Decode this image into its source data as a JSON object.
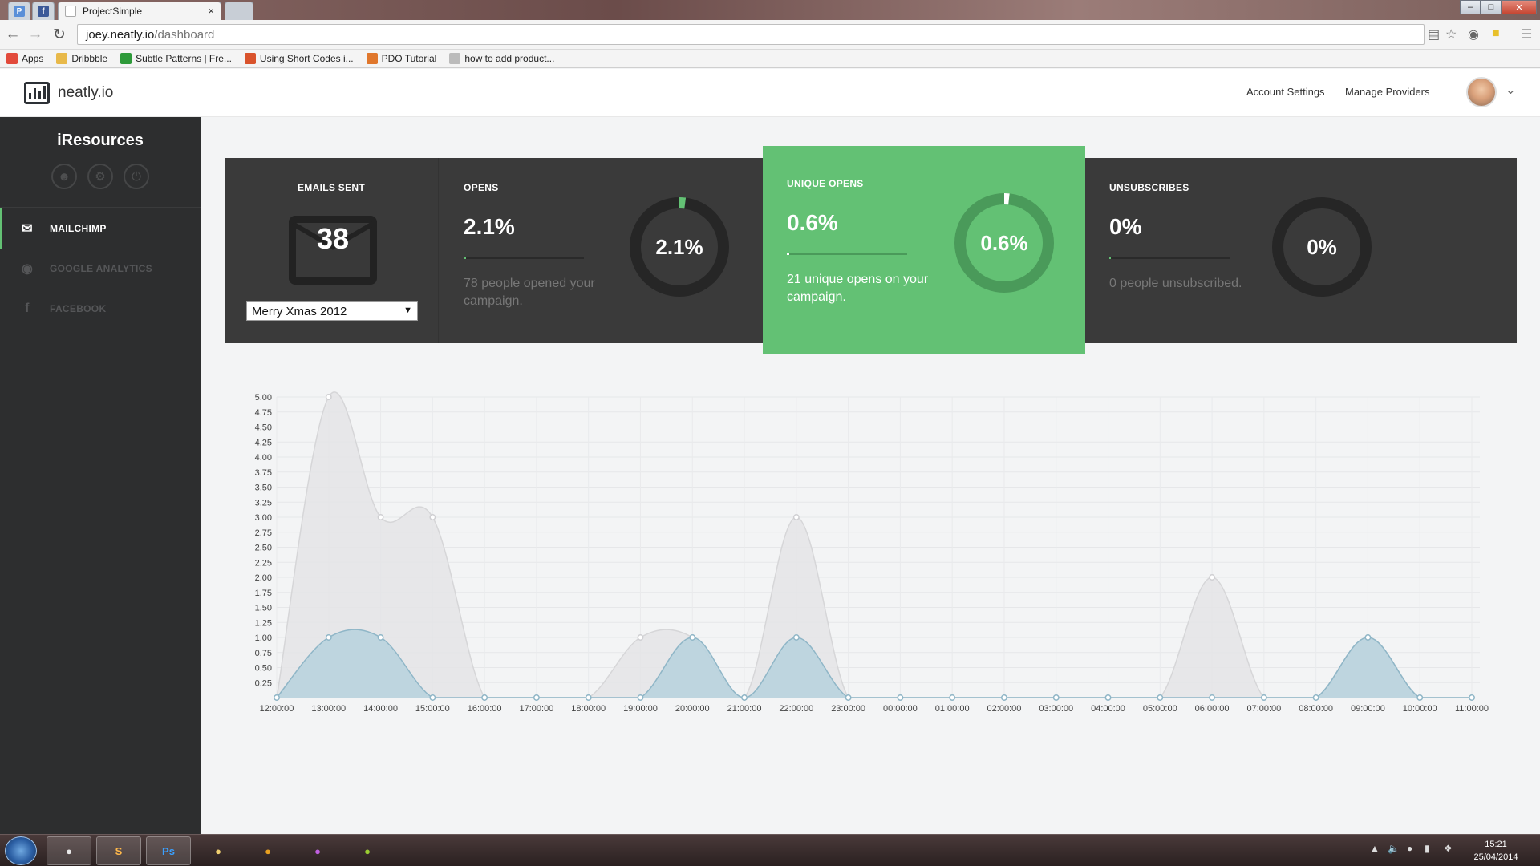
{
  "browser": {
    "tabs": [
      {
        "label": "ProjectSimple",
        "close": "×"
      }
    ],
    "url_host": "joey.neatly.io",
    "url_path": "/dashboard",
    "bookmarks": [
      {
        "label": "Apps",
        "icon": "apps-grid-icon",
        "color": "#e24a3b"
      },
      {
        "label": "Dribbble",
        "icon": "folder-icon",
        "color": "#e8b94a"
      },
      {
        "label": "Subtle Patterns | Fre...",
        "icon": "subtle-patterns-icon",
        "color": "#2e9a3a"
      },
      {
        "label": "Using Short Codes i...",
        "icon": "m-icon",
        "color": "#d9532c"
      },
      {
        "label": "PDO Tutorial",
        "icon": "plus-icon",
        "color": "#e0772c"
      },
      {
        "label": "how to add product...",
        "icon": "page-icon",
        "color": "#bbbbbb"
      }
    ]
  },
  "app": {
    "logo_text": "neatly.io",
    "nav": {
      "account_settings": "Account Settings",
      "manage_providers": "Manage Providers"
    }
  },
  "sidebar": {
    "brand": "iResources",
    "items": [
      {
        "label": "MAILCHIMP",
        "icon": "envelope-icon",
        "active": true
      },
      {
        "label": "GOOGLE ANALYTICS",
        "icon": "eye-icon",
        "active": false
      },
      {
        "label": "FACEBOOK",
        "icon": "facebook-icon",
        "active": false
      }
    ]
  },
  "stats": {
    "emails_sent": {
      "label": "EMAILS SENT",
      "count": "38",
      "campaign": "Merry Xmas 2012"
    },
    "opens": {
      "label": "OPENS",
      "value": "2.1%",
      "desc": "78 people opened your campaign.",
      "donut_label": "2.1%",
      "fraction": 0.021
    },
    "unique_opens": {
      "label": "UNIQUE OPENS",
      "value": "0.6%",
      "desc": "21 unique opens on your campaign.",
      "donut_label": "0.6%",
      "fraction": 0.006
    },
    "unsubscribes": {
      "label": "UNSUBSCRIBES",
      "value": "0%",
      "desc": "0 people unsubscribed.",
      "donut_label": "0%",
      "fraction": 0
    }
  },
  "colors": {
    "accent": "#63c174",
    "panel": "#3a3a3a",
    "sidebar": "#2d2e2f",
    "series_total": "#e4e4e6",
    "series_unique": "#b9d3de"
  },
  "chart_data": {
    "type": "area",
    "x": [
      "12:00:00",
      "13:00:00",
      "14:00:00",
      "15:00:00",
      "16:00:00",
      "17:00:00",
      "18:00:00",
      "19:00:00",
      "20:00:00",
      "21:00:00",
      "22:00:00",
      "23:00:00",
      "00:00:00",
      "01:00:00",
      "02:00:00",
      "03:00:00",
      "04:00:00",
      "05:00:00",
      "06:00:00",
      "07:00:00",
      "08:00:00",
      "09:00:00",
      "10:00:00",
      "11:00:00"
    ],
    "series": [
      {
        "values": [
          0,
          5,
          3,
          3,
          0,
          0,
          0,
          1,
          1,
          0,
          3,
          0,
          0,
          0,
          0,
          0,
          0,
          0,
          2,
          0,
          0,
          1,
          0,
          0
        ]
      },
      {
        "values": [
          0,
          1,
          1,
          0,
          0,
          0,
          0,
          0,
          1,
          0,
          1,
          0,
          0,
          0,
          0,
          0,
          0,
          0,
          0,
          0,
          0,
          1,
          0,
          0
        ]
      }
    ],
    "y_ticks": [
      "0.25",
      "0.50",
      "0.75",
      "1.00",
      "1.25",
      "1.50",
      "1.75",
      "2.00",
      "2.25",
      "2.50",
      "2.75",
      "3.00",
      "3.25",
      "3.50",
      "3.75",
      "4.00",
      "4.25",
      "4.50",
      "4.75",
      "5.00"
    ],
    "ylim": [
      0,
      5
    ],
    "grid": true
  },
  "taskbar": {
    "apps": [
      {
        "name": "chrome-icon",
        "label": ""
      },
      {
        "name": "sublime-icon",
        "label": "S"
      },
      {
        "name": "photoshop-icon",
        "label": "Ps"
      },
      {
        "name": "explorer-icon",
        "label": ""
      },
      {
        "name": "outlook-icon",
        "label": ""
      },
      {
        "name": "paint-icon",
        "label": ""
      },
      {
        "name": "app-icon",
        "label": ""
      }
    ],
    "time": "15:21",
    "date": "25/04/2014"
  }
}
